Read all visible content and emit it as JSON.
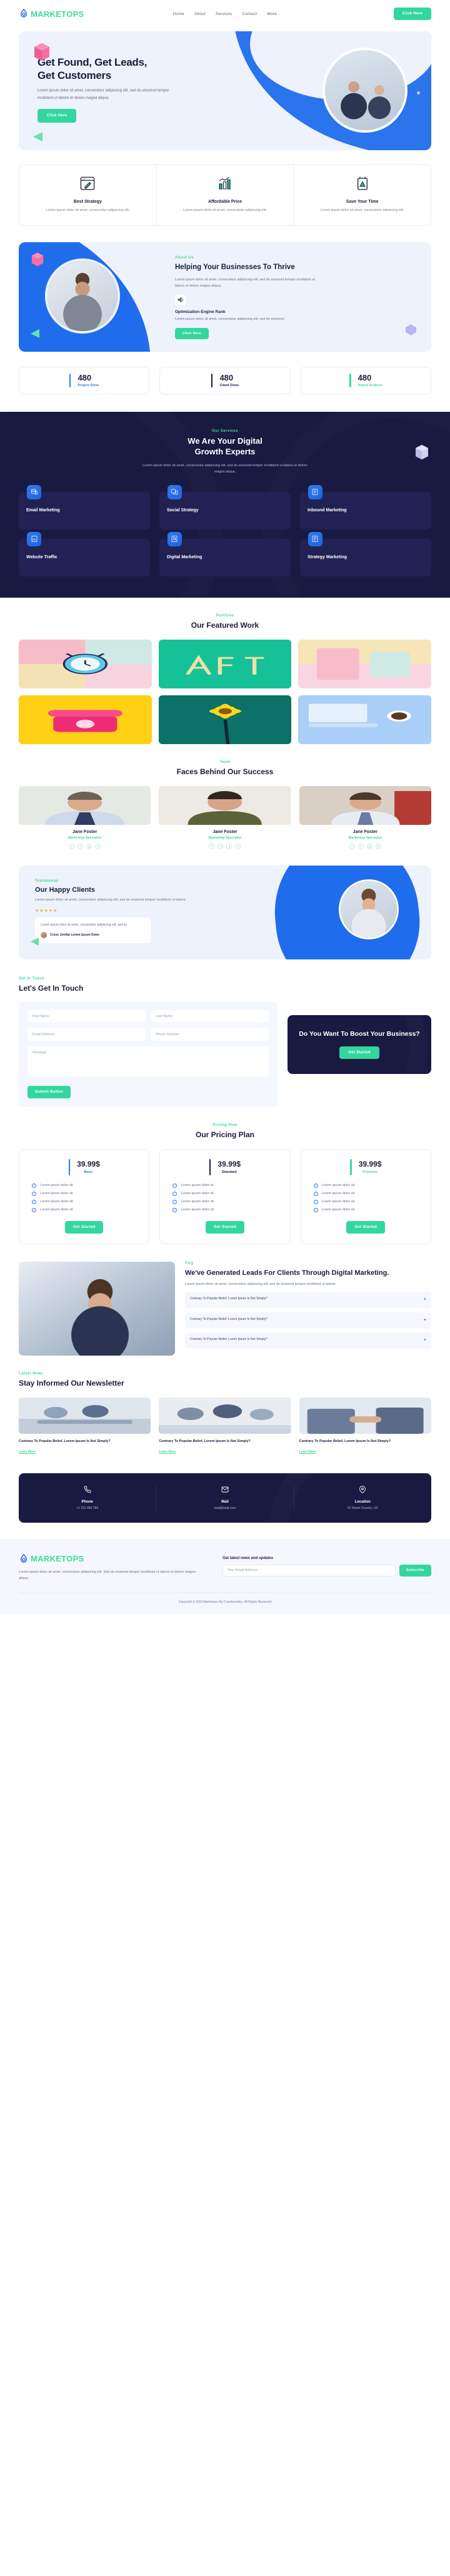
{
  "brand": {
    "name": "MARKETOPS",
    "icon": "droplet-logo-icon"
  },
  "header": {
    "nav": [
      {
        "label": "Home"
      },
      {
        "label": "About"
      },
      {
        "label": "Services"
      },
      {
        "label": "Contact"
      },
      {
        "label": "More -"
      }
    ],
    "cta_label": "Click Here"
  },
  "hero": {
    "title_line1": "Get Found, Get Leads,",
    "title_line2": "Get Customers",
    "paragraph": "Lorem ipsum dolor sit amet, consectetur adipiscing elit, sed do eiusmod tempor incididunt ut labore et dolore magna aliqua.",
    "button": "Click Here"
  },
  "features": [
    {
      "icon": "browser-pen-icon",
      "title": "Best Strategy",
      "text": "Lorem ipsum dolor sit amet, consectetur adipiscing elit."
    },
    {
      "icon": "bar-chart-icon",
      "title": "Affordable Price",
      "text": "Lorem ipsum dolor sit amet, consectetur adipiscing elit."
    },
    {
      "icon": "document-chart-icon",
      "title": "Save Your Time",
      "text": "Lorem ipsum dolor sit amet, consectetur adipiscing elit."
    }
  ],
  "about": {
    "eyebrow": "About Us",
    "title": "Helping Your Businesses To Thrive",
    "lead": "Lorem ipsum dolor sit amet, consectetur adipiscing elit, sed do eiusmod tempor incididunt ut labore et dolore magna aliqua.",
    "icon": "megaphone-icon",
    "subtitle": "Optimization Engine Rank",
    "subtext": "Lorem ipsum dolor sit amet, consectetur adipiscing elit, sed do eiusmod.",
    "button": "Click Here"
  },
  "stats": [
    {
      "value": "480",
      "label": "Project Done",
      "color": "#2f7bf0"
    },
    {
      "value": "480",
      "label": "Client Done",
      "color": "#191a42"
    },
    {
      "value": "480",
      "label": "Award Achieve",
      "color": "#3ddc97"
    }
  ],
  "services": {
    "eyebrow": "Our Services",
    "title_line1": "We Are Your Digital",
    "title_line2": "Growth Experts",
    "lead": "Lorem ipsum dolor sit amet, consectetur adipiscing elit, sed do eiusmod tempor incididunt ut labore et dolore magna aliqua.",
    "items": [
      {
        "icon": "email-marketing-icon",
        "title": "Email Marketing"
      },
      {
        "icon": "social-strategy-icon",
        "title": "Social Strategy"
      },
      {
        "icon": "inbound-marketing-icon",
        "title": "Inbound Marketing"
      },
      {
        "icon": "website-traffic-icon",
        "title": "Website Traffic"
      },
      {
        "icon": "digital-marketing-icon",
        "title": "Digital Marketing"
      },
      {
        "icon": "strategy-marketing-icon",
        "title": "Strategy Marketing"
      }
    ]
  },
  "portfolio": {
    "eyebrow": "Portfolio",
    "title": "Our Featured Work",
    "items": [
      {
        "name": "alarm-clock-photo",
        "color1": "#f7b8c8",
        "color2": "#ffd9e2"
      },
      {
        "name": "pasta-letters-photo",
        "color1": "#18c99a",
        "color2": "#13b489"
      },
      {
        "name": "pink-pastel-photo",
        "color1": "#f3e2b6",
        "color2": "#f8d7e4"
      },
      {
        "name": "pink-telephone-photo",
        "color1": "#ffd11a",
        "color2": "#ffc400"
      },
      {
        "name": "yellow-flower-photo",
        "color1": "#0b6b63",
        "color2": "#0f7d73"
      },
      {
        "name": "desk-coffee-photo",
        "color1": "#9fc9f7",
        "color2": "#bcd9fb"
      }
    ]
  },
  "team": {
    "eyebrow": "Team",
    "title": "Faces Behind Our Success",
    "members": [
      {
        "name": "Jane Foster",
        "role": "Marketing Specialist",
        "socials": [
          "twitter-icon",
          "facebook-icon",
          "google-icon",
          "instagram-icon"
        ]
      },
      {
        "name": "Jane Foster",
        "role": "Marketing Specialist",
        "socials": [
          "twitter-icon",
          "facebook-icon",
          "google-icon",
          "instagram-icon"
        ]
      },
      {
        "name": "Jane Foster",
        "role": "Marketing Specialist",
        "socials": [
          "twitter-icon",
          "facebook-icon",
          "google-icon",
          "instagram-icon"
        ]
      }
    ]
  },
  "testimonial": {
    "eyebrow": "Testimonial",
    "title": "Our Happy Clients",
    "lead": "Lorem ipsum dolor sit amet, consectetur adipiscing elit, sed do eiusmod tempor incididunt ut labore.",
    "stars": "★★★★★",
    "quote": "Lorem ipsum dolor sit amet, consectetur adipiscing elit, sed do.",
    "author": "Cross Jenifar Lorem Ipsum Dolor"
  },
  "contact": {
    "eyebrow": "Get In Touch",
    "title": "Let's Get In Touch",
    "first_name_placeholder": "First Name",
    "last_name_placeholder": "Last Name",
    "email_placeholder": "Email Address",
    "phone_placeholder": "Phone Number",
    "message_placeholder": "Message",
    "submit_label": "Submit Button",
    "cta_title": "Do You Want To Boost Your Business?",
    "cta_button": "Get Started"
  },
  "pricing": {
    "eyebrow": "Pricing Plan",
    "title": "Our Pricing Plan",
    "plans": [
      {
        "price": "39.99$",
        "name": "Basic",
        "color": "#2f7bf0",
        "features": [
          "Lorem ipsum dolor sit",
          "Lorem ipsum dolor sit",
          "Lorem ipsum dolor sit",
          "Lorem ipsum dolor sit"
        ],
        "button": "Get Started"
      },
      {
        "price": "39.99$",
        "name": "Standard",
        "color": "#191a42",
        "features": [
          "Lorem ipsum dolor sit",
          "Lorem ipsum dolor sit",
          "Lorem ipsum dolor sit",
          "Lorem ipsum dolor sit"
        ],
        "button": "Get Started"
      },
      {
        "price": "39.99$",
        "name": "Premium",
        "color": "#3ddc97",
        "features": [
          "Lorem ipsum dolor sit",
          "Lorem ipsum dolor sit",
          "Lorem ipsum dolor sit",
          "Lorem ipsum dolor sit"
        ],
        "button": "Get Started"
      }
    ]
  },
  "faq": {
    "eyebrow": "FAQ",
    "title": "We've Generated Leads For Clients Through Digital Marketing.",
    "lead": "Lorem ipsum dolor sit amet, consectetur adipiscing elit, sed do eiusmod tempor incididunt ut labore.",
    "items": [
      {
        "question": "Contrary To Popular Belief, Lorem Ipsum Is Not Simply?",
        "toggle": "+"
      },
      {
        "question": "Contrary To Popular Belief, Lorem Ipsum Is Not Simply?",
        "toggle": "+"
      },
      {
        "question": "Contrary To Popular Belief, Lorem Ipsum Is Not Simply?",
        "toggle": "+"
      }
    ]
  },
  "blog": {
    "eyebrow": "Latest News",
    "title": "Stay Informed Our Newsletter",
    "posts": [
      {
        "title": "Contrary To Popular Belief, Lorem Ipsum Is Not Simply?",
        "link": "Learn More",
        "image": "office-meeting-photo"
      },
      {
        "title": "Contrary To Popular Belief, Lorem Ipsum Is Not Simply?",
        "link": "Learn More",
        "image": "team-discussion-photo"
      },
      {
        "title": "Contrary To Popular Belief, Lorem Ipsum Is Not Simply?",
        "link": "Learn More",
        "image": "handshake-photo"
      }
    ]
  },
  "contact_bar": [
    {
      "icon": "phone-icon",
      "title": "Phone",
      "value": "+1 321 456 789"
    },
    {
      "icon": "mail-icon",
      "title": "Mail",
      "value": "mail@mail.com"
    },
    {
      "icon": "location-icon",
      "title": "Location",
      "value": "01 Street Country, US"
    }
  ],
  "footer": {
    "description": "Lorem ipsum dolor sit amet, consectetur adipiscing elit. Sed do eiusmod tempor incididunt ut labore et dolore magna aliqua.",
    "newsletter_heading": "Get latest news and updates",
    "email_placeholder": "Your Email Address",
    "subscribe_label": "Subscribe",
    "copyright": "Copyright © 2023 Marketops By Counterstrike. All Rights Reserved"
  },
  "colors": {
    "green": "#33d69f",
    "blue": "#2f7bf0",
    "dark": "#191a42",
    "light_blue_bg": "#eef2fd"
  }
}
